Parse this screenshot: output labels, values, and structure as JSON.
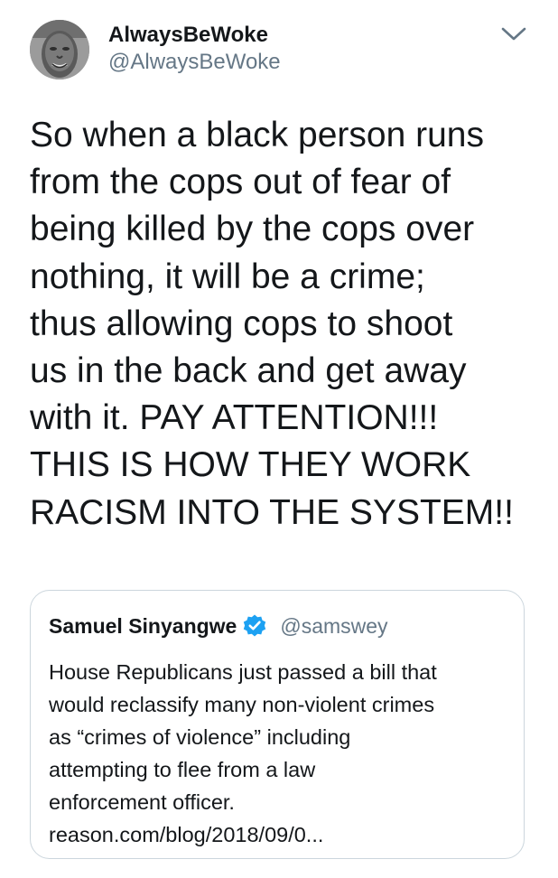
{
  "author": {
    "display_name": "AlwaysBeWoke",
    "handle": "@AlwaysBeWoke",
    "avatar_icon": "profile-photo"
  },
  "menu": {
    "icon": "chevron-down-icon"
  },
  "tweet": {
    "text": "So when a black person runs\nfrom the cops out of fear of\nbeing killed by the cops over\nnothing, it will be a crime;\nthus allowing cops to shoot\nus in the back and get away\nwith it. PAY ATTENTION!!!\nTHIS IS HOW THEY WORK\nRACISM INTO THE SYSTEM!!"
  },
  "quoted_tweet": {
    "display_name": "Samuel Sinyangwe",
    "verified_icon": "verified-badge-icon",
    "handle": "@samswey",
    "text": "House Republicans just passed a bill that\nwould reclassify many non-violent crimes\nas “crimes of violence” including\nattempting to flee from a law\nenforcement officer.\nreason.com/blog/2018/09/0..."
  },
  "colors": {
    "text_primary": "#14171a",
    "text_secondary": "#657786",
    "verified_blue": "#1da1f2",
    "card_border": "#ccd6dd"
  }
}
